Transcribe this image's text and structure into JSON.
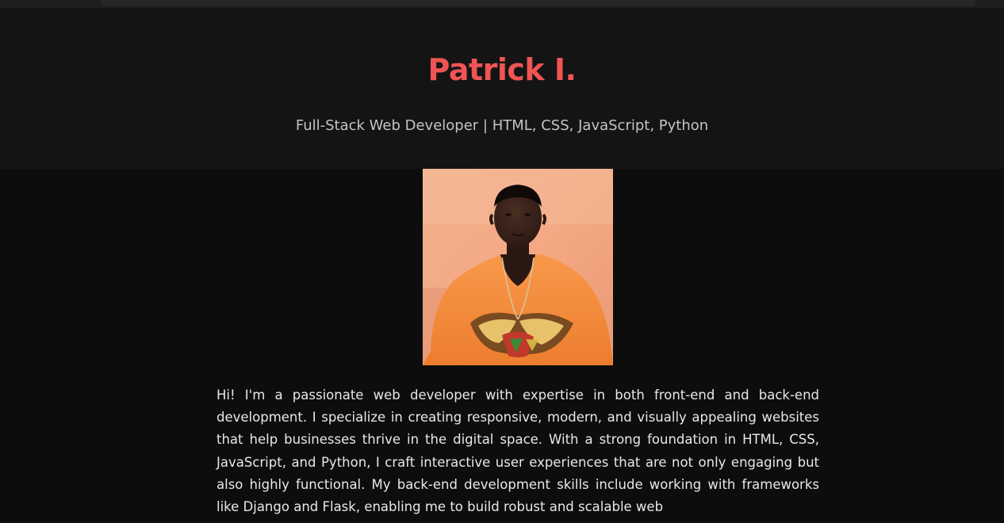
{
  "profile": {
    "name": "Patrick I.",
    "title": "Full-Stack Web Developer | HTML, CSS, JavaScript, Python",
    "bio": "Hi! I'm a passionate web developer with expertise in both front-end and back-end development. I specialize in creating responsive, modern, and visually appealing websites that help businesses thrive in the digital space. With a strong foundation in HTML, CSS, JavaScript, and Python, I craft interactive user experiences that are not only engaging but also highly functional. My back-end development skills include working with frameworks like Django and Flask, enabling me to build robust and scalable web"
  },
  "colors": {
    "accent": "#f05454",
    "header_bg": "#141414",
    "page_bg": "#0d0d0d",
    "subtitle_text": "#c4c4c4",
    "body_text": "#e8e8e8"
  }
}
